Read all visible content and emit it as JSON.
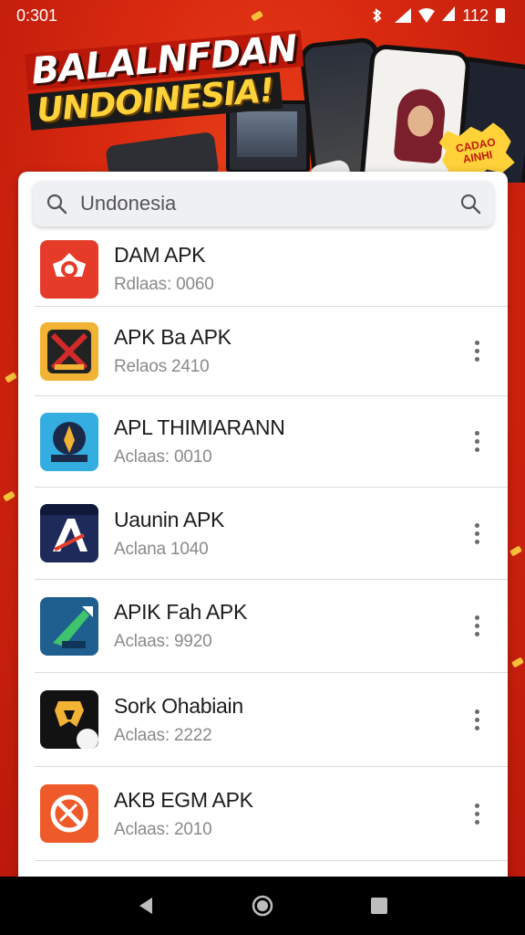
{
  "status_bar": {
    "time": "0:301",
    "battery": "112"
  },
  "hero": {
    "headline_line1": "BALALNFDAN",
    "headline_line2": "UNDOINESIA!",
    "badge": "CADAO AINHI"
  },
  "search": {
    "value": "Undonesia",
    "placeholder": "Undonesia"
  },
  "apps": [
    {
      "name": "DAM APK",
      "subtitle": "Rdlaas: 0060",
      "icon": "red-ring-icon",
      "color": "#e53c2a",
      "menu": false
    },
    {
      "name": "APK Ba APK",
      "subtitle": "Relaos 2410",
      "icon": "crossed-swords-icon",
      "color": "#f2b233",
      "menu": true
    },
    {
      "name": "APL THIMIARANN",
      "subtitle": "Aclaas: 0010",
      "icon": "shield-crest-icon",
      "color": "#34aee0",
      "menu": true
    },
    {
      "name": "Uaunin APK",
      "subtitle": "Aclana 1040",
      "icon": "a-letter-icon",
      "color": "#1d2a5a",
      "menu": true
    },
    {
      "name": "APIK Fah APK",
      "subtitle": "Aclaas: 9920",
      "icon": "green-arrow-icon",
      "color": "#1f5f8f",
      "menu": true
    },
    {
      "name": "Sork Ohabiain",
      "subtitle": "Aclaas: 2222",
      "icon": "yellow-leaf-icon",
      "color": "#121212",
      "menu": true
    },
    {
      "name": "AKB EGM APK",
      "subtitle": "Aclaas: 2010",
      "icon": "no-sign-icon",
      "color": "#ef5a2a",
      "menu": true
    }
  ],
  "colors": {
    "background": "#d92a10",
    "accent_yellow": "#ffd23a"
  }
}
